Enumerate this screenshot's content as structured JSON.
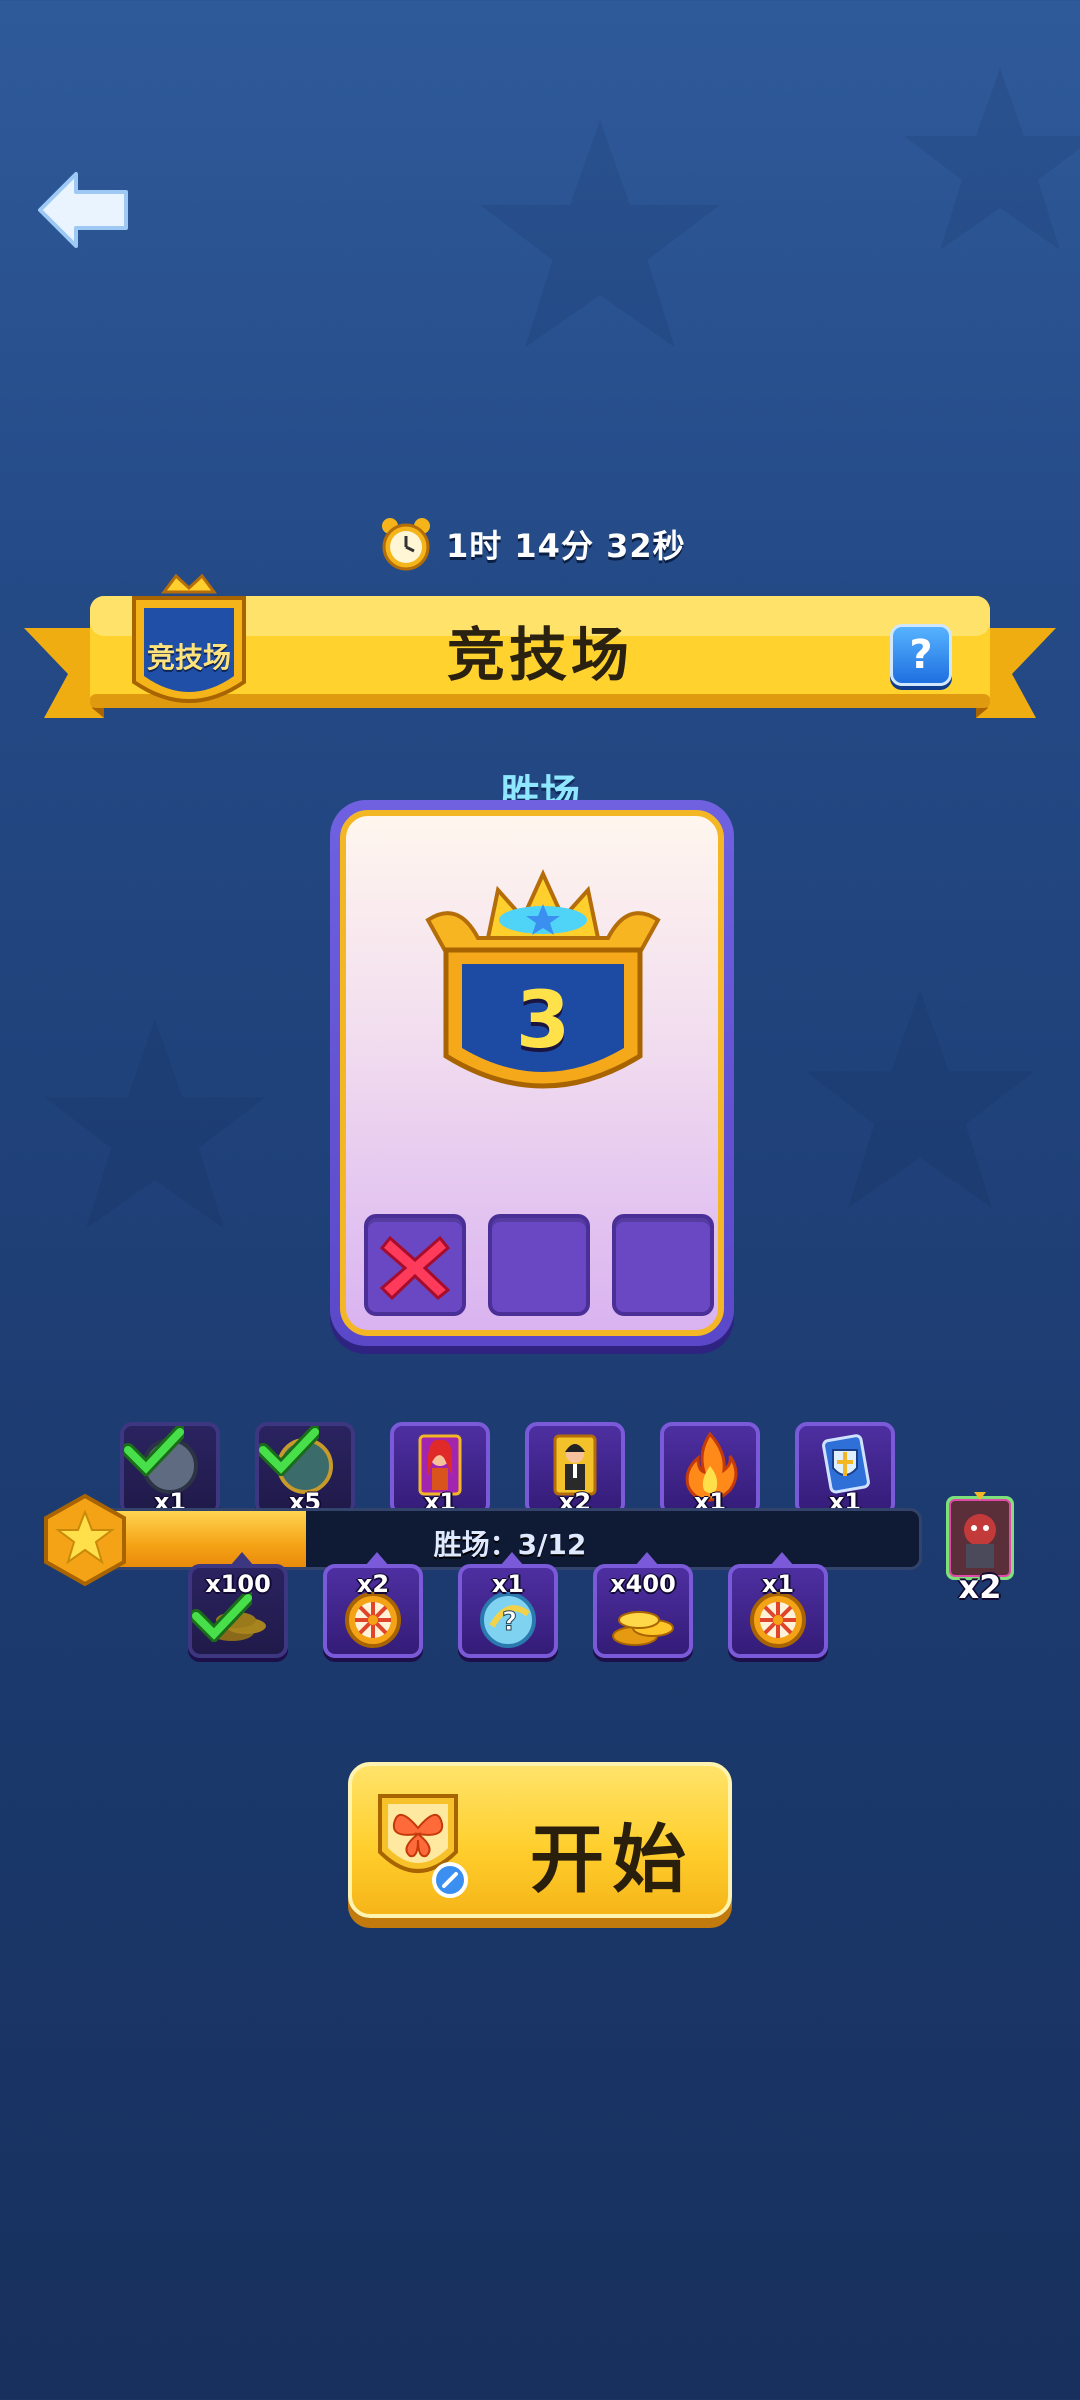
{
  "header": {
    "timer": "1时 14分 32秒",
    "title": "竞技场",
    "badge_text": "竞技场",
    "help_label": "?"
  },
  "win_panel": {
    "label": "胜场",
    "wins": "3",
    "slots": [
      {
        "state": "lost"
      },
      {
        "state": "empty"
      },
      {
        "state": "empty"
      }
    ]
  },
  "progress": {
    "text": "胜场：3/12",
    "current": 3,
    "total": 12,
    "top_rewards": [
      {
        "icon": "clock-token-icon",
        "qty": "x1",
        "claimed": true
      },
      {
        "icon": "badge-token-icon",
        "qty": "x5",
        "claimed": true
      },
      {
        "icon": "red-hair-character-card-icon",
        "qty": "x1",
        "claimed": false
      },
      {
        "icon": "suit-character-card-icon",
        "qty": "x2",
        "claimed": false
      },
      {
        "icon": "flame-boost-icon",
        "qty": "x1",
        "claimed": false
      },
      {
        "icon": "shield-card-icon",
        "qty": "x1",
        "claimed": false
      }
    ],
    "bottom_rewards": [
      {
        "icon": "coins-icon",
        "qty": "x100",
        "claimed": true
      },
      {
        "icon": "spin-wheel-icon",
        "qty": "x2",
        "claimed": false
      },
      {
        "icon": "mystery-token-icon",
        "qty": "x1",
        "claimed": false
      },
      {
        "icon": "coins-icon",
        "qty": "x400",
        "claimed": false
      },
      {
        "icon": "spin-wheel-icon",
        "qty": "x1",
        "claimed": false
      }
    ],
    "final_reward": {
      "icon": "monster-card-icon",
      "qty": "x2"
    }
  },
  "start_button": {
    "label": "开始"
  },
  "colors": {
    "accent": "#f5b51a",
    "panel": "#5a48c9",
    "fill": "#f5a316"
  }
}
